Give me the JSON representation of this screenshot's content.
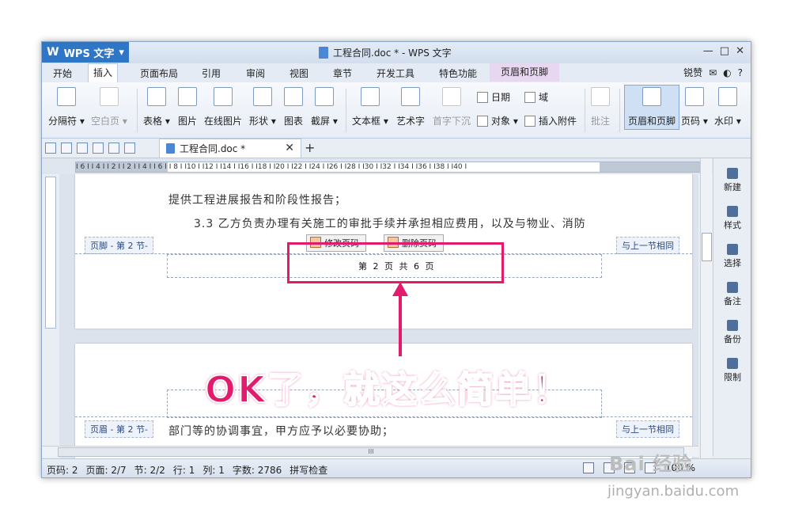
{
  "app": {
    "name": "WPS 文字",
    "logo": "W",
    "window_title": "工程合同.doc * - WPS 文字"
  },
  "window_controls": [
    "锐赞",
    "—",
    "□",
    "✕"
  ],
  "menus": [
    "开始",
    "插入",
    "页面布局",
    "引用",
    "审阅",
    "视图",
    "章节",
    "开发工具",
    "特色功能",
    "页眉和页脚"
  ],
  "menu_active": "插入",
  "menu_right": [
    "锐赞",
    "?"
  ],
  "ribbon": {
    "buttons": [
      {
        "label": "分隔符 ▾",
        "state": "normal"
      },
      {
        "label": "空白页 ▾",
        "state": "disabled"
      },
      {
        "label": "表格 ▾",
        "state": "normal"
      },
      {
        "label": "图片",
        "state": "normal"
      },
      {
        "label": "在线图片",
        "state": "normal"
      },
      {
        "label": "形状 ▾",
        "state": "normal"
      },
      {
        "label": "图表",
        "state": "normal"
      },
      {
        "label": "截屏 ▾",
        "state": "normal"
      },
      {
        "label": "文本框 ▾",
        "state": "normal"
      },
      {
        "label": "艺术字",
        "state": "normal"
      },
      {
        "label": "首字下沉",
        "state": "disabled"
      },
      {
        "label": "批注",
        "state": "disabled"
      },
      {
        "label": "页眉和页脚",
        "state": "selected"
      },
      {
        "label": "页码 ▾",
        "state": "normal"
      },
      {
        "label": "水印 ▾",
        "state": "normal"
      }
    ],
    "small": {
      "date": "日期",
      "field": "域",
      "object": "对象 ▾",
      "attach": "插入附件"
    }
  },
  "doc_tab": {
    "title": "工程合同.doc *",
    "close": "✕",
    "new_tab": "+"
  },
  "ruler_text": "I 6 I  I 4 I  I 2 I     I 2 I  I 4 I  I 6 I  I 8 I  I10 I  I12 I  I14 I  I16 I  I18 I  I20 I  I22 I  I24 I  I26 I  I28 I  I30 I  I32 I  I34 I  I36 I  I38 I  I40 I",
  "page1": {
    "line1": "提供工程进展报告和阶段性报告；",
    "line2": "3.3  乙方负责办理有关施工的审批手续并承担相应费用，以及与物业、消防",
    "footer_tag": "页脚 - 第 2 节-",
    "same_as_prev": "与上一节相同",
    "btn_modify": "修改页码",
    "btn_delete": "删除页码",
    "page_number": "第 2 页 共 6 页"
  },
  "page2": {
    "header_tag": "页眉 - 第 2 节-",
    "same_as_prev": "与上一节相同",
    "line1": "部门等的协调事宜，甲方应予以必要协助；"
  },
  "annotation": {
    "text": "OK了，就这么简单！",
    "color": "#e31b6d"
  },
  "right_panel": [
    "新建",
    "样式",
    "选择",
    "备注",
    "备份",
    "限制"
  ],
  "status": {
    "page_code": "页码: 2",
    "page": "页面: 2/7",
    "section": "节: 2/2",
    "row": "行: 1",
    "col": "列: 1",
    "words": "字数: 2786",
    "spell": "拼写检查",
    "zoom": "100 %"
  },
  "watermark": {
    "brand": "Bai 经验",
    "url": "jingyan.baidu.com"
  },
  "scroll_label": "III"
}
